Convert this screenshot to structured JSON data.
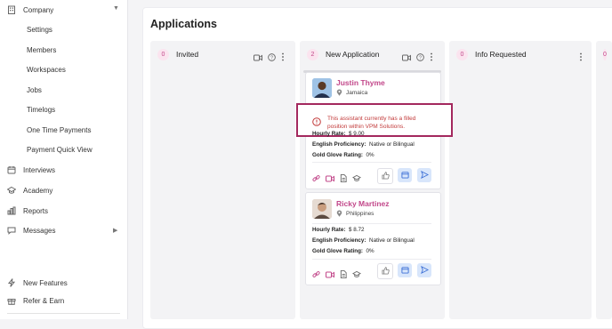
{
  "sidebar": {
    "company": "Company",
    "sub_items": [
      "Settings",
      "Members",
      "Workspaces",
      "Jobs",
      "Timelogs",
      "One Time Payments",
      "Payment Quick View"
    ],
    "items": {
      "interviews": "Interviews",
      "academy": "Academy",
      "reports": "Reports",
      "messages": "Messages",
      "new_features": "New Features",
      "refer": "Refer & Earn"
    }
  },
  "page_title": "Applications",
  "columns": [
    {
      "count": "0",
      "title": "Invited"
    },
    {
      "count": "2",
      "title": "New Application"
    },
    {
      "count": "0",
      "title": "Info Requested"
    },
    {
      "count": "0",
      "title": ""
    }
  ],
  "cards": [
    {
      "name": "Justin Thyme",
      "location": "Jamaica",
      "warning": "This assistant currently has a filled position within VPM Solutions.",
      "hourly_label": "Hourly Rate:",
      "hourly": "$ 9.00",
      "english_label": "English Proficiency:",
      "english": "Native or Bilingual",
      "gold_label": "Gold Glove Rating:",
      "gold": "0%"
    },
    {
      "name": "Ricky Martinez",
      "location": "Philippines",
      "hourly_label": "Hourly Rate:",
      "hourly": "$ 8.72",
      "english_label": "English Proficiency:",
      "english": "Native or Bilingual",
      "gold_label": "Gold Glove Rating:",
      "gold": "0%"
    }
  ],
  "colors": {
    "accent": "#c2478a",
    "warning_border": "#a3285e",
    "warning_text": "#c23a3a",
    "badge_bg": "#fbe4ef"
  }
}
